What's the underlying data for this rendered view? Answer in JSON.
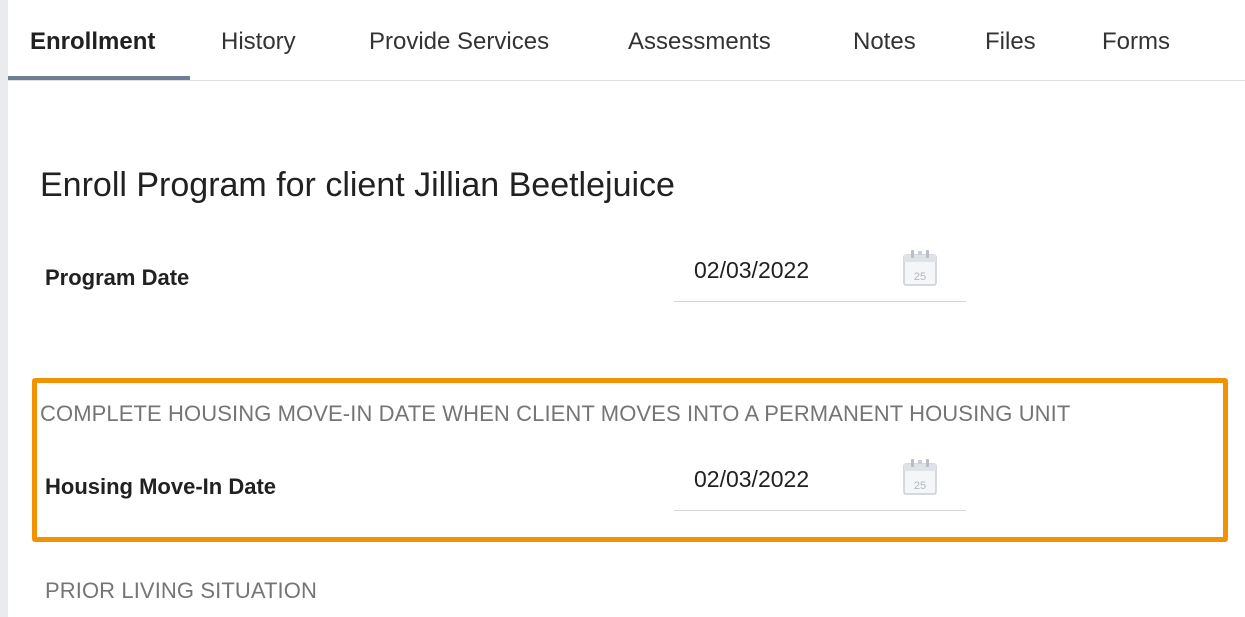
{
  "tabs": [
    {
      "label": "Enrollment"
    },
    {
      "label": "History"
    },
    {
      "label": "Provide Services"
    },
    {
      "label": "Assessments"
    },
    {
      "label": "Notes"
    },
    {
      "label": "Files"
    },
    {
      "label": "Forms"
    }
  ],
  "active_tab": "Enrollment",
  "page": {
    "title": "Enroll Program for client Jillian Beetlejuice"
  },
  "program_date": {
    "label": "Program Date",
    "value": "02/03/2022",
    "icon": "calendar-icon",
    "icon_day": "25"
  },
  "housing_section": {
    "heading": "COMPLETE HOUSING MOVE-IN DATE WHEN CLIENT MOVES INTO A PERMANENT HOUSING UNIT",
    "field_label": "Housing Move-In Date",
    "value": "02/03/2022",
    "icon": "calendar-icon",
    "icon_day": "25",
    "highlight_color": "#f39200"
  },
  "prior_living": {
    "heading": "PRIOR LIVING SITUATION"
  },
  "colors": {
    "active_tab_underline": "#6e7f95",
    "section_heading": "#757575",
    "highlight": "#f39200"
  }
}
